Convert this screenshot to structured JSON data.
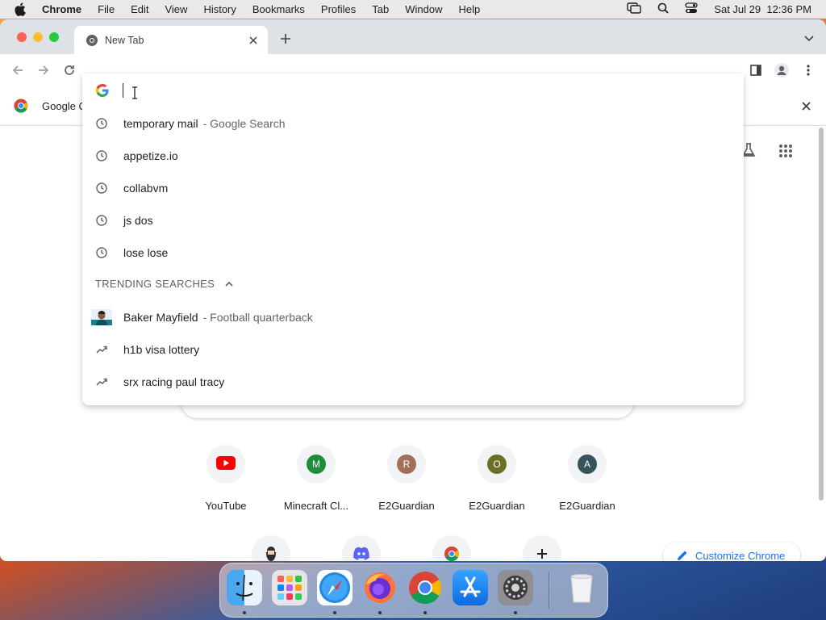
{
  "menubar": {
    "app_name": "Chrome",
    "items": [
      "File",
      "Edit",
      "View",
      "History",
      "Bookmarks",
      "Profiles",
      "Tab",
      "Window",
      "Help"
    ],
    "datetime": "Sat Jul 29  12:36 PM"
  },
  "tab": {
    "title": "New Tab"
  },
  "infobar": {
    "text": "Google C"
  },
  "omnibox": {
    "value": "",
    "suggestions": [
      {
        "main": "temporary mail",
        "sub": "- Google Search",
        "icon": "history-icon"
      },
      {
        "main": "appetize.io",
        "sub": "",
        "icon": "history-icon"
      },
      {
        "main": "collabvm",
        "sub": "",
        "icon": "history-icon"
      },
      {
        "main": "js dos",
        "sub": "",
        "icon": "history-icon"
      },
      {
        "main": "lose lose",
        "sub": "",
        "icon": "history-icon"
      }
    ],
    "trending_header": "TRENDING SEARCHES",
    "trending": [
      {
        "main": "Baker Mayfield",
        "sub": "- Football quarterback",
        "icon": "person-thumbnail"
      },
      {
        "main": "h1b visa lottery",
        "sub": "",
        "icon": "trending-icon"
      },
      {
        "main": "srx racing paul tracy",
        "sub": "",
        "icon": "trending-icon"
      }
    ]
  },
  "shortcuts": [
    {
      "label": "YouTube",
      "icon": "youtube-icon"
    },
    {
      "label": "Minecraft Cl...",
      "letter": "M",
      "color": "#1e8e3e"
    },
    {
      "label": "E2Guardian",
      "letter": "R",
      "color": "#a0705a"
    },
    {
      "label": "E2Guardian",
      "letter": "O",
      "color": "#6b7026"
    },
    {
      "label": "E2Guardian",
      "letter": "A",
      "color": "#37545c"
    }
  ],
  "shortcuts_row2": [
    {
      "icon": "bearded-man-icon"
    },
    {
      "icon": "discord-icon"
    },
    {
      "icon": "chrome-icon"
    },
    {
      "icon": "add-shortcut-icon"
    }
  ],
  "customize": {
    "label": "Customize Chrome"
  },
  "dock": [
    "finder",
    "launchpad",
    "safari",
    "firefox",
    "chrome",
    "app-store",
    "system-settings",
    "trash"
  ],
  "colors": {
    "accent": "#1a73e8",
    "tabstrip": "#dee1e6"
  }
}
